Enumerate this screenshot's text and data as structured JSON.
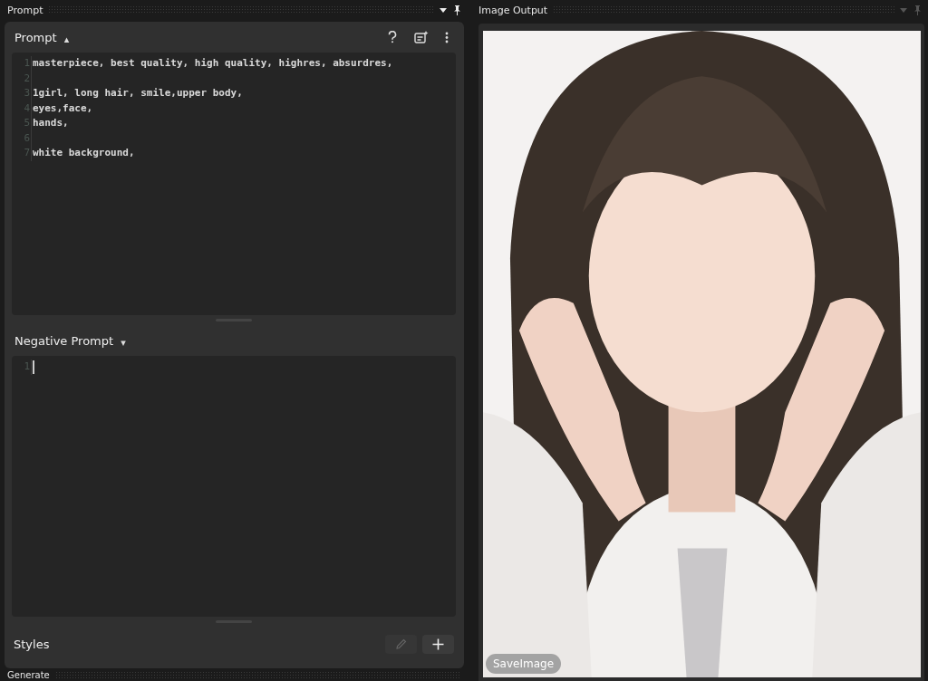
{
  "prompt_panel": {
    "title": "Prompt",
    "prompt": {
      "label": "Prompt",
      "caret": "▴",
      "lines": [
        {
          "number": "1",
          "text": "masterpiece, best quality, high quality, highres, absurdres,"
        },
        {
          "number": "2"
        },
        {
          "number": "3",
          "text": "1girl, long hair, smile,upper body,"
        },
        {
          "number": "4",
          "text": "eyes,face,"
        },
        {
          "number": "5",
          "text": "hands,"
        },
        {
          "number": "6"
        },
        {
          "number": "7",
          "text": "white background,"
        }
      ]
    },
    "negative_prompt": {
      "label": "Negative Prompt",
      "caret": "▾",
      "focused": true,
      "lines": [
        {
          "number": "1"
        }
      ]
    },
    "styles": {
      "label": "Styles",
      "edit_disabled": true
    }
  },
  "image_panel": {
    "title": "Image Output",
    "save_button": "SaveImage"
  },
  "generate_panel": {
    "title": "Generate"
  }
}
